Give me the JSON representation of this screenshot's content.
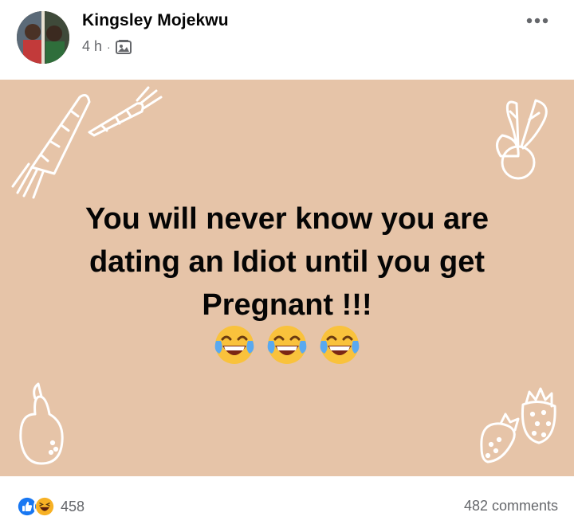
{
  "post": {
    "author": "Kingsley Mojekwu",
    "time": "4 h",
    "separator": "·",
    "audience_icon": "photo-album-icon",
    "more_icon": "more-dots-icon",
    "text_lines": [
      "You will never know you are",
      "dating an Idiot until you get",
      "Pregnant !!!"
    ],
    "emojis": [
      "😂",
      "😂",
      "😂"
    ],
    "background_color": "#e6c4a8",
    "decorations": [
      "carrot-icon",
      "carrot-icon",
      "beet-icon",
      "pear-icon",
      "strawberry-icon",
      "strawberry-icon"
    ]
  },
  "footer": {
    "reaction_icons": [
      "like-icon",
      "haha-icon"
    ],
    "reaction_count": "458",
    "comments": "482 comments"
  },
  "colors": {
    "like_blue": "#1877f2",
    "haha_yellow": "#f7b125",
    "secondary_text": "#65676b"
  }
}
